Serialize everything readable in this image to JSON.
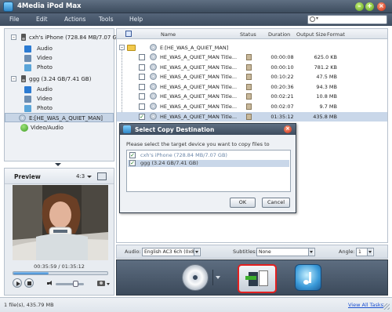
{
  "app": {
    "title": "4Media iPod Max",
    "min_glyph": "–",
    "max_glyph": "+",
    "close_glyph": "×"
  },
  "menu": [
    "File",
    "Edit",
    "Actions",
    "Tools",
    "Help"
  ],
  "search": {
    "placeholder": "",
    "dropdown_glyph": "▾"
  },
  "device_tree": {
    "devices": [
      {
        "toggle": "–",
        "label": "cxh's iPhone (728.84 MB/7.07 GB)",
        "children": [
          "Audio",
          "Video",
          "Photo"
        ]
      },
      {
        "toggle": "–",
        "label": "ggg (3.24 GB/7.41 GB)",
        "children": [
          "Audio",
          "Video",
          "Photo"
        ]
      }
    ],
    "disc_label": "E:[HE_WAS_A_QUIET_MAN]",
    "video_audio_label": "Video/Audio"
  },
  "preview": {
    "title": "Preview",
    "aspect": "4:3",
    "timecode": "00:35:59 / 01:35:12",
    "progress": 0.377,
    "volume": 0.7
  },
  "file_list": {
    "columns": [
      "Name",
      "Status",
      "Duration",
      "Output Size",
      "Format"
    ],
    "folder_toggle": "–",
    "folder_name": "E:[HE_WAS_A_QUIET_MAN]",
    "rows": [
      {
        "name": "HE_WAS_A_QUIET_MAN Title...",
        "duration": "00:00:08",
        "size": "625.0 KB",
        "checked": false,
        "selected": false
      },
      {
        "name": "HE_WAS_A_QUIET_MAN Title...",
        "duration": "00:00:10",
        "size": "781.2 KB",
        "checked": false,
        "selected": false
      },
      {
        "name": "HE_WAS_A_QUIET_MAN Title...",
        "duration": "00:10:22",
        "size": "47.5 MB",
        "checked": false,
        "selected": false
      },
      {
        "name": "HE_WAS_A_QUIET_MAN Title...",
        "duration": "00:20:36",
        "size": "94.3 MB",
        "checked": false,
        "selected": false
      },
      {
        "name": "HE_WAS_A_QUIET_MAN Title...",
        "duration": "00:02:21",
        "size": "10.8 MB",
        "checked": false,
        "selected": false
      },
      {
        "name": "HE_WAS_A_QUIET_MAN Title...",
        "duration": "00:02:07",
        "size": "9.7 MB",
        "checked": false,
        "selected": false
      },
      {
        "name": "HE_WAS_A_QUIET_MAN Title...",
        "duration": "01:35:12",
        "size": "435.8 MB",
        "checked": true,
        "selected": true
      }
    ]
  },
  "dialog": {
    "title": "Select Copy Destination",
    "close_glyph": "×",
    "prompt": "Please select the target device you want to copy files to",
    "devices": [
      {
        "label": "cxh's iPhone (728.84 MB/7.07 GB)",
        "checked": true,
        "selected": false
      },
      {
        "label": "ggg (3.24 GB/7.41 GB)",
        "checked": true,
        "selected": true
      }
    ],
    "ok": "OK",
    "cancel": "Cancel"
  },
  "options": {
    "audio_label": "Audio:",
    "audio_value": "English AC3 6ch (0x80)",
    "subtitles_label": "Subtitles:",
    "subtitles_value": "None",
    "angle_label": "Angle:",
    "angle_value": "1"
  },
  "status": {
    "text": "1 file(s), 435.79 MB",
    "view_all_tasks": "View All Tasks"
  },
  "colors": {
    "accent": "#3a86cf",
    "highlight_border": "#e32020",
    "selection": "#c9d7e9",
    "titlebar": "#4a5a6e"
  },
  "icons": {
    "device": "ipod-icon",
    "audio": "audio-icon",
    "video": "video-icon",
    "photo": "photo-icon",
    "disc": "disc-icon",
    "dvd_action": "dvd-disc-icon",
    "copy_action": "copy-to-device-icon",
    "itunes_action": "itunes-icon"
  }
}
